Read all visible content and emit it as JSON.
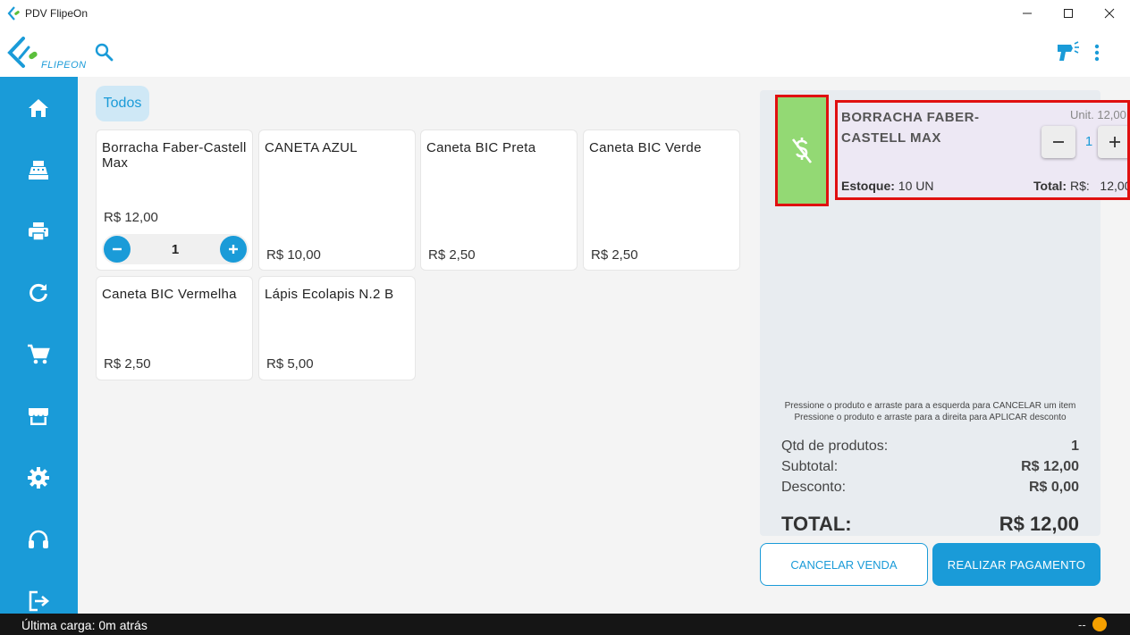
{
  "window": {
    "title": "PDV FlipeOn",
    "icon": "flipeon-app-icon"
  },
  "appbar": {
    "logo_text": "FLIPEON",
    "search_icon": "search-icon",
    "scanner_icon": "barcode-scanner-icon",
    "more_icon": "more-vertical-icon"
  },
  "sidebar": {
    "items": [
      {
        "icon": "home-icon"
      },
      {
        "icon": "cash-register-icon"
      },
      {
        "icon": "printer-icon"
      },
      {
        "icon": "refresh-icon"
      },
      {
        "icon": "cart-icon"
      },
      {
        "icon": "store-icon"
      },
      {
        "icon": "settings-icon"
      },
      {
        "icon": "headset-icon"
      },
      {
        "icon": "logout-icon"
      }
    ]
  },
  "filter": {
    "label": "Todos"
  },
  "products": [
    {
      "name": "Borracha Faber-Castell Max",
      "price": "R$ 12,00",
      "qty": "1"
    },
    {
      "name": "CANETA AZUL",
      "price": "R$ 10,00"
    },
    {
      "name": "Caneta BIC Preta",
      "price": "R$ 2,50"
    },
    {
      "name": "Caneta BIC Verde",
      "price": "R$ 2,50"
    },
    {
      "name": "Caneta BIC Vermelha",
      "price": "R$ 2,50"
    },
    {
      "name": "Lápis Ecolapis N.2 B",
      "price": "R$ 5,00"
    }
  ],
  "cart": {
    "item": {
      "name": "BORRACHA FABER-CASTELL MAX",
      "unit": "Unit. 12,00",
      "qty": "1",
      "stock_label": "Estoque:",
      "stock_value": "10 UN",
      "total_label": "Total:",
      "total_value": "R$:   12,00",
      "swipe_icon": "no-money-icon"
    },
    "hint_line1": "Pressione o produto e arraste para a esquerda para CANCELAR um item",
    "hint_line2": "Pressione o produto e arraste para a direita para APLICAR desconto",
    "summary": {
      "qty_label": "Qtd de produtos:",
      "qty_value": "1",
      "subtotal_label": "Subtotal:",
      "subtotal_value": "R$ 12,00",
      "discount_label": "Desconto:",
      "discount_value": "R$ 0,00",
      "total_label": "TOTAL:",
      "total_value": "R$ 12,00"
    }
  },
  "actions": {
    "cancel_label": "CANCELAR VENDA",
    "pay_label": "REALIZAR PAGAMENTO"
  },
  "status": {
    "last_load": "Última carga: 0m atrás",
    "dash": "--"
  },
  "colors": {
    "primary": "#1a9bd8",
    "swipe_green": "#93d974",
    "highlight_red": "#e01010",
    "status_orange": "#f5a000"
  }
}
